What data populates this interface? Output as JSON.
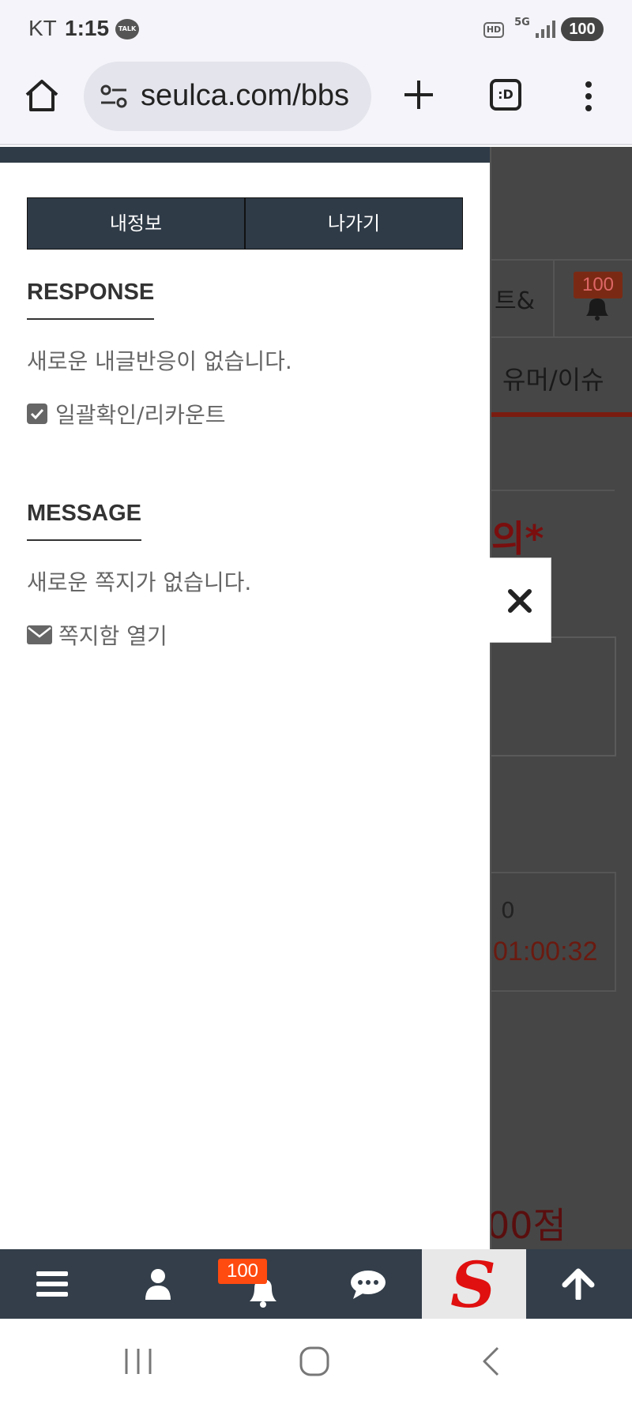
{
  "status_bar": {
    "carrier": "KT",
    "time": "1:15",
    "talk_label": "TALK",
    "hd_label": "HD",
    "network_label": "5G",
    "battery": "100"
  },
  "browser": {
    "url": "seulca.com/bbs",
    "tab_label": ":D"
  },
  "background_page": {
    "ticket_fragment": "트&",
    "badge_count": "100",
    "tab_humor": "유머/이슈",
    "title_fragment": "의*",
    "count_zero": "0",
    "time_fragment": "01:00:32",
    "score_fragment": "00점"
  },
  "drawer": {
    "my_info_label": "내정보",
    "logout_label": "나가기",
    "response": {
      "title": "RESPONSE",
      "empty_text": "새로운 내글반응이 없습니다.",
      "bulk_link": "일괄확인/리카운트"
    },
    "message": {
      "title": "MESSAGE",
      "empty_text": "새로운 쪽지가 없습니다.",
      "open_link": "쪽지함 열기"
    }
  },
  "bottom_nav": {
    "notification_count": "100",
    "logo_letter": "S"
  },
  "colors": {
    "drawer_button_bg": "#2f3b47",
    "nav_bg": "#333e4a",
    "badge_bg": "#ff4a10"
  }
}
